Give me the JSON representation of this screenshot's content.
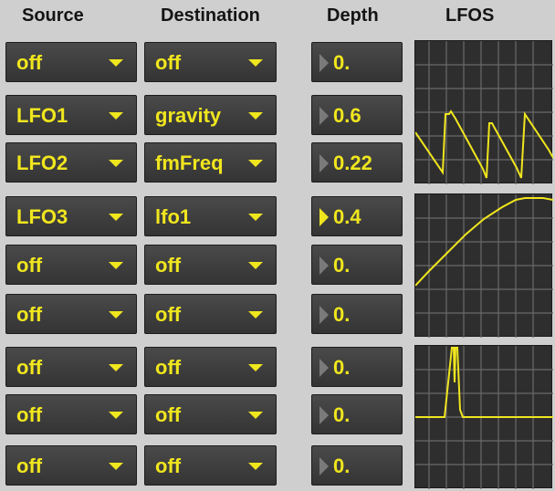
{
  "headers": {
    "source": "Source",
    "destination": "Destination",
    "depth": "Depth",
    "lfos": "LFOS"
  },
  "rows": [
    {
      "source": "off",
      "destination": "off",
      "depth": "0.",
      "active": false
    },
    {
      "source": "LFO1",
      "destination": "gravity",
      "depth": "0.6",
      "active": false
    },
    {
      "source": "LFO2",
      "destination": "fmFreq",
      "depth": "0.22",
      "active": false
    },
    {
      "source": "LFO3",
      "destination": "lfo1",
      "depth": "0.4",
      "active": true
    },
    {
      "source": "off",
      "destination": "off",
      "depth": "0.",
      "active": false
    },
    {
      "source": "off",
      "destination": "off",
      "depth": "0.",
      "active": false
    },
    {
      "source": "off",
      "destination": "off",
      "depth": "0.",
      "active": false
    },
    {
      "source": "off",
      "destination": "off",
      "depth": "0.",
      "active": false
    },
    {
      "source": "off",
      "destination": "off",
      "depth": "0.",
      "active": false
    }
  ],
  "colors": {
    "accent": "#f0e61e",
    "panel": "#3c3c3c",
    "background": "#cfcfcf",
    "scope_bg": "#2e2e2e",
    "grid": "#6a6a6a"
  },
  "icons": {
    "dropdown": "chevron-down-icon",
    "depth_indicator": "play-triangle-icon"
  }
}
